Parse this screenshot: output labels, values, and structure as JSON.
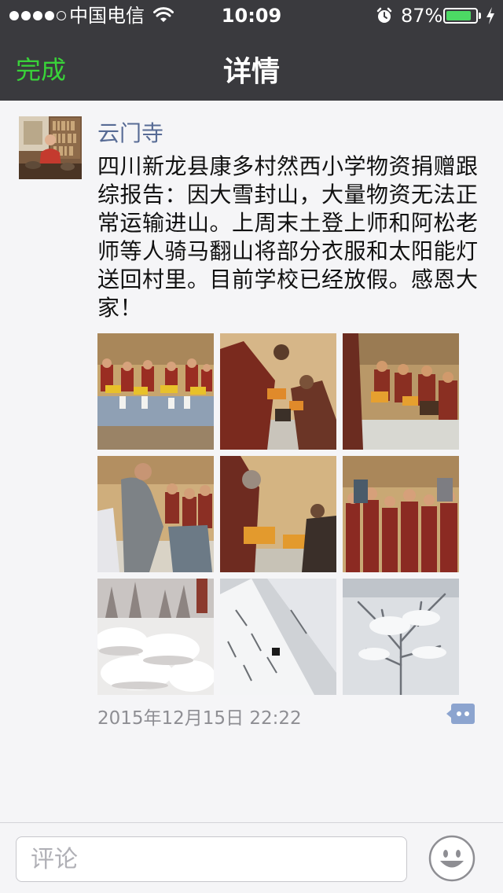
{
  "status_bar": {
    "carrier": "中国电信",
    "time": "10:09",
    "battery_percent": "87%",
    "battery_level": 0.87,
    "signal_bars": 4,
    "signal_bars_total": 5,
    "icons": [
      "signal-dots-icon",
      "wifi-icon",
      "alarm-icon",
      "battery-icon",
      "charging-icon"
    ]
  },
  "nav": {
    "done_label": "完成",
    "title": "详情"
  },
  "post": {
    "author": "云门寺",
    "text": "四川新龙县康多村然西小学物资捐赠跟综报告：因大雪封山，大量物资无法正常运输进山。上周末土登上师和阿松老师等人骑马翻山将部分衣服和太阳能灯送回村里。目前学校已经放假。感恩大家！",
    "timestamp": "2015年12月15日 22:22",
    "photos": [
      "photo-monks-seated-with-donations",
      "photo-monk-handing-out-supplies",
      "photo-group-receiving-items",
      "photo-man-giving-gifts-to-children",
      "photo-elder-monk-distributing",
      "photo-young-monks-standing",
      "photo-snowy-forest",
      "photo-snowy-mountain-slope",
      "photo-snow-covered-tree"
    ]
  },
  "comment_bar": {
    "placeholder": "评论"
  },
  "colors": {
    "nav_background": "#3a3a3e",
    "done_green": "#39d239",
    "author_link": "#576b95",
    "battery_green": "#4cd964",
    "timestamp_gray": "#8e8e93",
    "comment_icon_blue": "#8ca4cf"
  }
}
